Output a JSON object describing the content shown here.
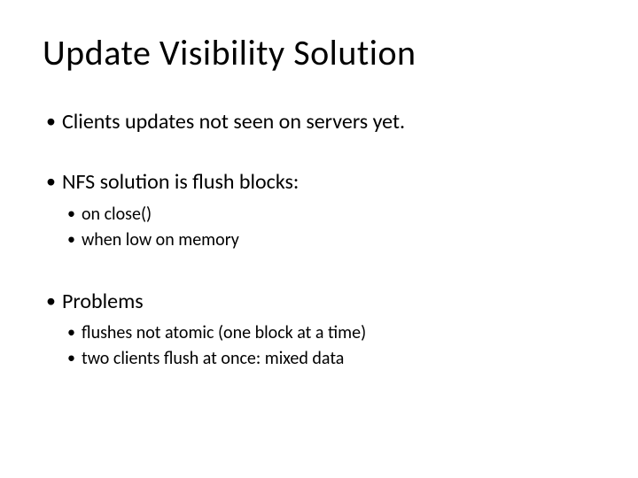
{
  "title": "Update Visibility Solution",
  "bullets": {
    "b1": "Clients updates not seen on servers yet.",
    "b2": "NFS solution is flush blocks:",
    "b2a": "on close()",
    "b2b": "when low on memory",
    "b3": "Problems",
    "b3a": "flushes not atomic (one block at a time)",
    "b3b": "two clients flush at once: mixed data"
  }
}
